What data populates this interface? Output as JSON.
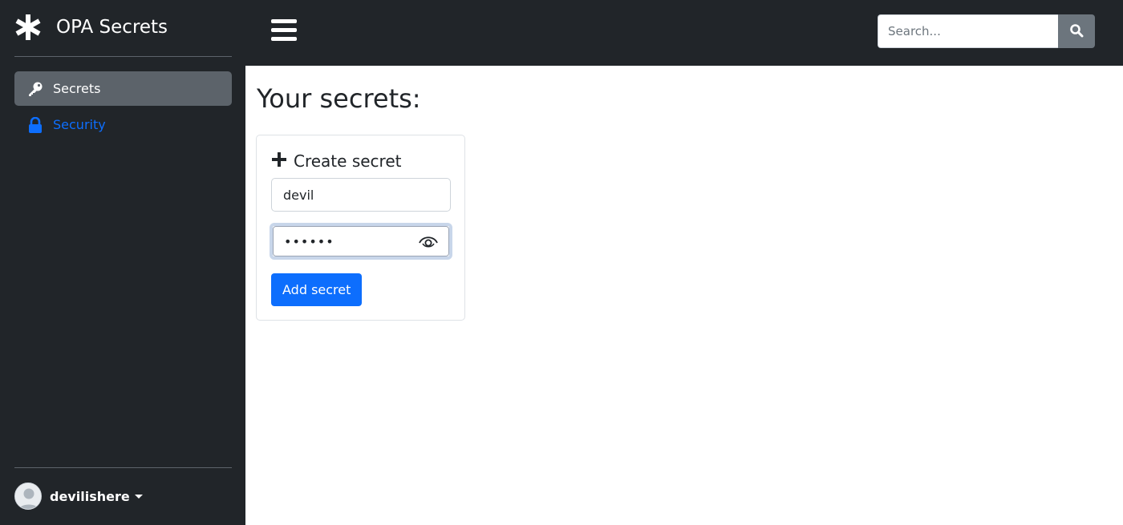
{
  "brand": {
    "title": "OPA Secrets",
    "icon": "asterisk-icon"
  },
  "sidebar": {
    "items": [
      {
        "label": "Secrets",
        "icon": "key-icon",
        "active": true
      },
      {
        "label": "Security",
        "icon": "lock-icon",
        "active": false
      }
    ]
  },
  "user": {
    "name": "devilishere",
    "avatar": "avatar-placeholder-icon"
  },
  "topbar": {
    "menu_icon": "hamburger-icon"
  },
  "search": {
    "placeholder": "Search...",
    "value": "",
    "icon": "search-icon"
  },
  "main": {
    "title": "Your secrets:",
    "card": {
      "title": "Create secret",
      "icon": "plus-icon",
      "name_value": "devil",
      "password_value": "••••••",
      "eye_icon": "eye-icon",
      "button_label": "Add secret"
    }
  },
  "colors": {
    "sidebar_bg": "#212529",
    "active_item_bg": "#5c636a",
    "link_blue": "#0d6efd",
    "primary_button": "#0d6efd",
    "search_button": "#6c757d"
  }
}
